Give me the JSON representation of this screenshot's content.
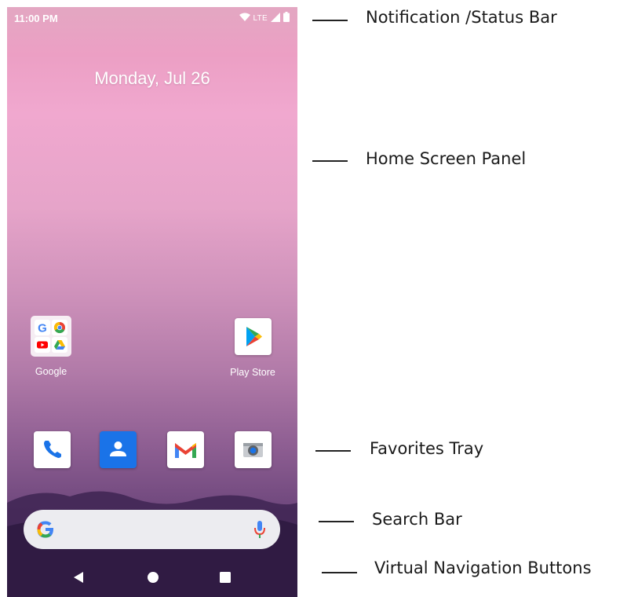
{
  "status_bar": {
    "time": "11:00 PM",
    "network": "LTE",
    "icons": [
      "wifi-icon",
      "signal-icon",
      "battery-icon"
    ]
  },
  "home": {
    "date": "Monday, Jul 26",
    "apps": [
      {
        "label": "Google",
        "icon": "google-folder-icon"
      },
      {
        "label": "Play Store",
        "icon": "play-store-icon"
      }
    ]
  },
  "favorites": [
    {
      "icon": "phone-icon",
      "color": "#1a73e8"
    },
    {
      "icon": "contacts-icon",
      "color": "#1a73e8"
    },
    {
      "icon": "gmail-icon",
      "color": "#ea4335"
    },
    {
      "icon": "camera-icon",
      "color": "#5f6368"
    }
  ],
  "search_bar": {
    "icons": [
      "google-g-icon",
      "mic-icon"
    ]
  },
  "nav_buttons": [
    "back-icon",
    "home-icon",
    "recents-icon"
  ],
  "callouts": {
    "status_bar": "Notification /Status Bar",
    "home_screen_panel": "Home Screen Panel",
    "favorites_tray": "Favorites Tray",
    "search_bar": "Search Bar",
    "virtual_navigation": "Virtual Navigation Buttons"
  }
}
